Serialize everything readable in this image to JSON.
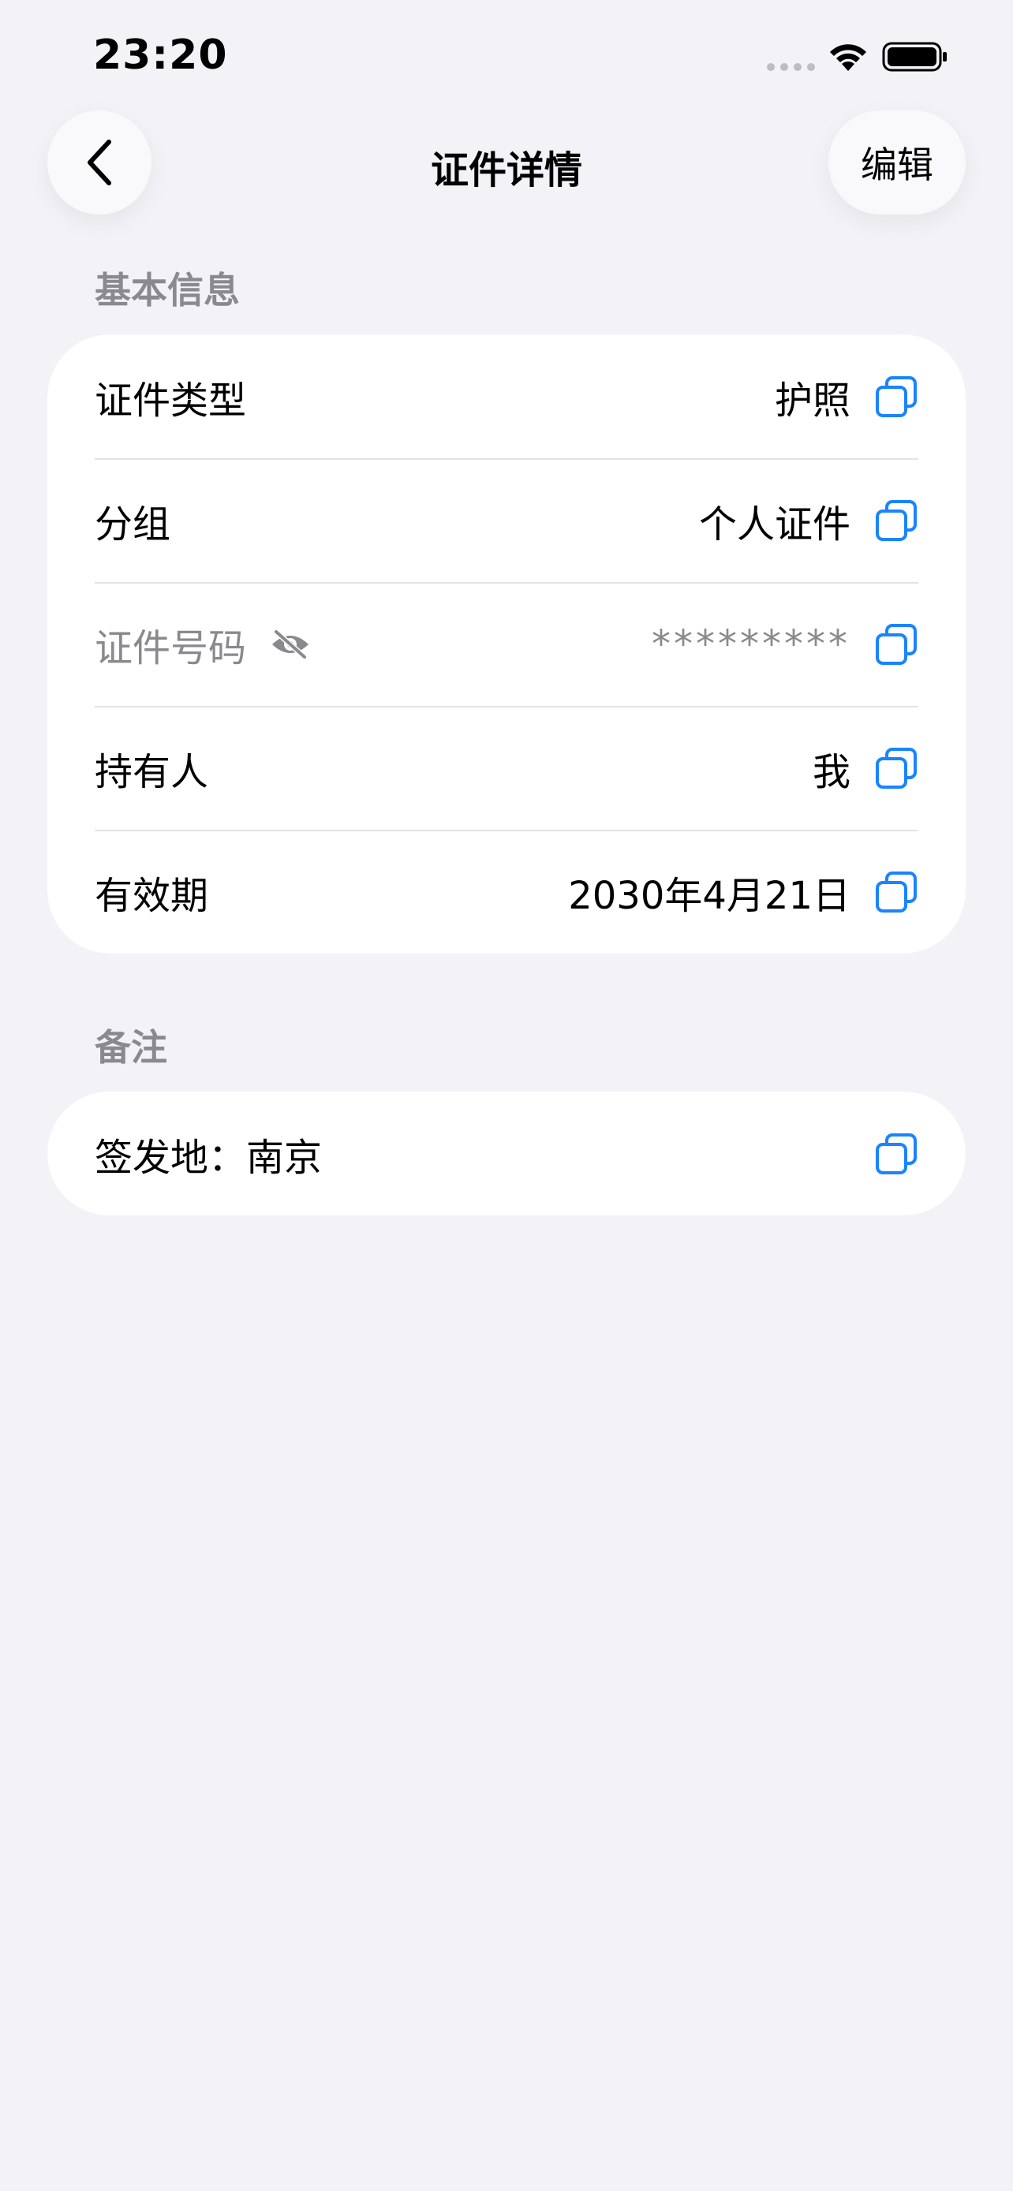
{
  "status_bar": {
    "time": "23:20",
    "icons": [
      "signal-dots-icon",
      "wifi-icon",
      "battery-icon"
    ]
  },
  "nav": {
    "back_icon": "chevron-left-icon",
    "title": "证件详情",
    "edit_label": "编辑"
  },
  "basic_info": {
    "header": "基本信息",
    "rows": [
      {
        "label": "证件类型",
        "value": "护照"
      },
      {
        "label": "分组",
        "value": "个人证件"
      },
      {
        "label": "证件号码",
        "value": "*********",
        "hidden_icon": "eye-slash-icon"
      },
      {
        "label": "持有人",
        "value": "我"
      },
      {
        "label": "有效期",
        "value": "2030年4月21日"
      }
    ]
  },
  "notes": {
    "header": "备注",
    "text": "签发地：南京"
  },
  "colors": {
    "background": "#f2f2f7",
    "card": "#ffffff",
    "accent": "#1a84ff",
    "secondary_text": "#8a8a8e"
  }
}
